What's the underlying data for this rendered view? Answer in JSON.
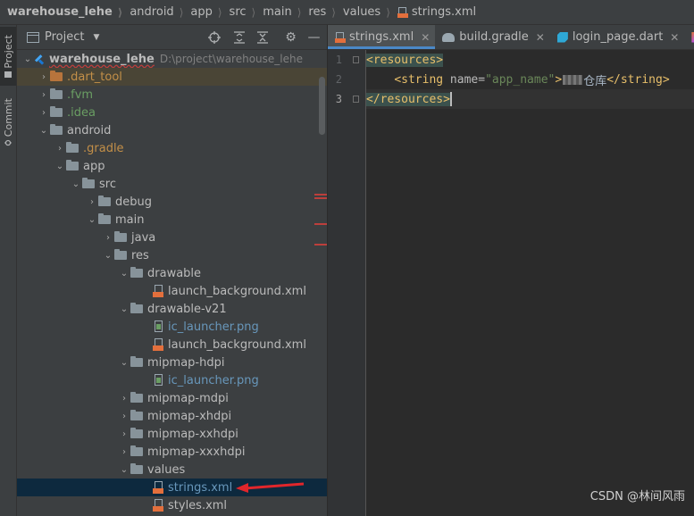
{
  "breadcrumb": {
    "items": [
      "warehouse_lehe",
      "android",
      "app",
      "src",
      "main",
      "res",
      "values",
      "strings.xml"
    ]
  },
  "tool_stripe": {
    "project_tab": "Project",
    "commit_tab": "Commit"
  },
  "project_panel": {
    "title": "Project",
    "tree": [
      {
        "label": "warehouse_lehe",
        "path_hint": "D:\\project\\warehouse_lehe"
      },
      {
        "label": ".dart_tool"
      },
      {
        "label": ".fvm"
      },
      {
        "label": ".idea"
      },
      {
        "label": "android"
      },
      {
        "label": ".gradle"
      },
      {
        "label": "app"
      },
      {
        "label": "src"
      },
      {
        "label": "debug"
      },
      {
        "label": "main"
      },
      {
        "label": "java"
      },
      {
        "label": "res"
      },
      {
        "label": "drawable"
      },
      {
        "label": "launch_background.xml"
      },
      {
        "label": "drawable-v21"
      },
      {
        "label": "ic_launcher.png"
      },
      {
        "label": "launch_background.xml"
      },
      {
        "label": "mipmap-hdpi"
      },
      {
        "label": "ic_launcher.png"
      },
      {
        "label": "mipmap-mdpi"
      },
      {
        "label": "mipmap-xhdpi"
      },
      {
        "label": "mipmap-xxhdpi"
      },
      {
        "label": "mipmap-xxxhdpi"
      },
      {
        "label": "values"
      },
      {
        "label": "strings.xml"
      },
      {
        "label": "styles.xml"
      }
    ]
  },
  "editor": {
    "tabs": [
      {
        "label": "strings.xml",
        "active": true
      },
      {
        "label": "build.gradle"
      },
      {
        "label": "login_page.dart"
      },
      {
        "label": "k"
      }
    ],
    "line_numbers": [
      "1",
      "2",
      "3"
    ],
    "code": {
      "line1_tag": "<resources>",
      "line2_open": "<string",
      "line2_attr": " name=",
      "line2_value": "\"app_name\"",
      "line2_gt": ">",
      "line2_text": "仓库",
      "line2_close": "</string>",
      "line3_tag": "</resources>"
    }
  },
  "watermark": "CSDN @林间风雨",
  "colors": {
    "accent": "#4a88c7",
    "selection": "#0d293e",
    "error": "#bc3f3c",
    "arrow": "#e0262b"
  }
}
